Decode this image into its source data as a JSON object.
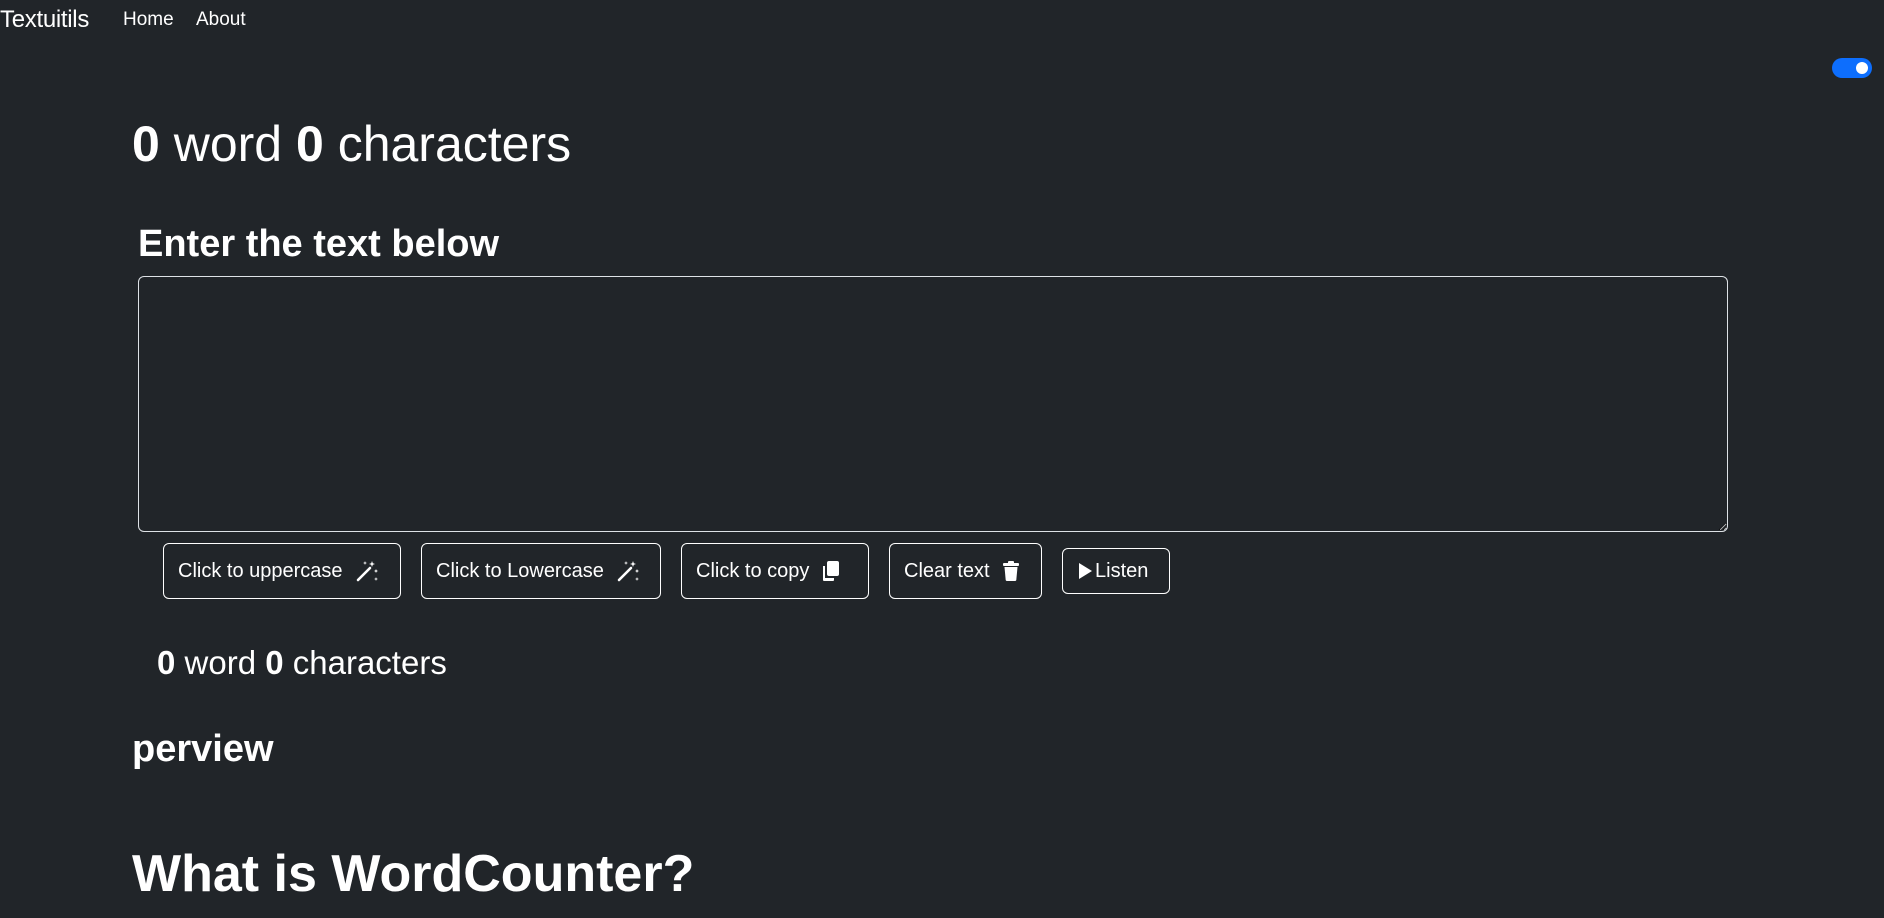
{
  "navbar": {
    "brand": "Textuitils",
    "links": [
      "Home",
      "About"
    ]
  },
  "toggle": {
    "checked": true,
    "color": "#0d6efd",
    "icon": "toggle-switch-icon"
  },
  "summary_top": {
    "words": "0",
    "word_label": " word ",
    "chars": "0",
    "char_label": " characters"
  },
  "form": {
    "heading": "Enter the text below",
    "textarea_value": ""
  },
  "buttons": {
    "uppercase": {
      "label": "Click to uppercase",
      "icon": "magic-wand-icon"
    },
    "lowercase": {
      "label": "Click to Lowercase",
      "icon": "magic-wand-icon"
    },
    "copy": {
      "label": "Click to copy",
      "icon": "copy-icon"
    },
    "clear": {
      "label": "Clear text",
      "icon": "trash-icon"
    },
    "listen": {
      "label": "Listen",
      "icon": "play-icon"
    }
  },
  "summary_bottom": {
    "words": "0",
    "word_label": " word ",
    "chars": "0",
    "char_label": " characters"
  },
  "preview": {
    "heading": "perview"
  },
  "about": {
    "heading": "What is WordCounter?"
  },
  "colors": {
    "background": "#212529",
    "text": "#ffffff",
    "accent": "#0d6efd"
  }
}
